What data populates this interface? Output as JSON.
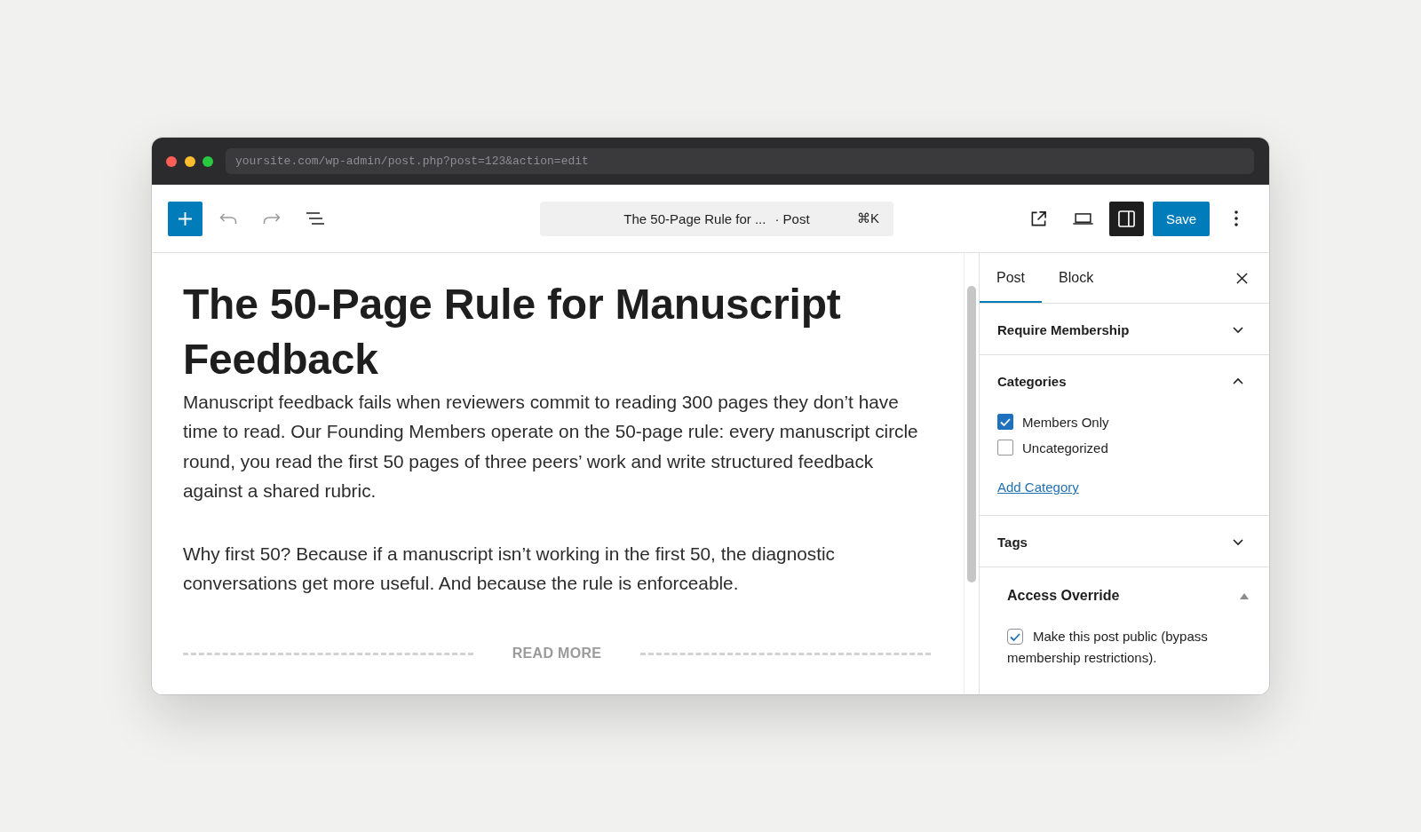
{
  "browser": {
    "url": "yoursite.com/wp-admin/post.php?post=123&action=edit"
  },
  "toolbar": {
    "undo": {
      "disabled": true
    },
    "redo": {
      "disabled": true
    },
    "document": {
      "title": "The 50-Page Rule for ...",
      "type": "· Post",
      "shortcut": "⌘K"
    },
    "settings_toggle": {
      "pressed": true
    },
    "save": "Save"
  },
  "editor": {
    "title": "The 50-Page Rule for Manuscript Feedback",
    "paragraphs": [
      "Manuscript feedback fails when reviewers commit to reading 300 pages they don’t have time to read. Our Founding Members operate on the 50-page rule: every manuscript circle round, you read the first 50 pages of three peers’ work and write structured feedback against a shared rubric.",
      "Why first 50? Because if a manuscript isn’t working in the first 50, the diagnostic conversations get more useful. And because the rule is enforceable."
    ],
    "read_more": "READ MORE"
  },
  "sidebar": {
    "tabs": [
      {
        "label": "Post",
        "selected": true
      },
      {
        "label": "Block",
        "selected": false
      }
    ],
    "panels": [
      {
        "kind": "panel",
        "title": "Require Membership",
        "expanded": false
      },
      {
        "kind": "panel",
        "title": "Categories",
        "expanded": true,
        "options": [
          {
            "label": "Members Only",
            "checked": true
          },
          {
            "label": "Uncategorized",
            "checked": false
          }
        ],
        "link": "Add Category"
      },
      {
        "kind": "panel",
        "title": "Tags",
        "expanded": false
      },
      {
        "kind": "metabox",
        "title": "Access Override",
        "expanded": true,
        "options": [
          {
            "label": "Make this post public (bypass membership restrictions).",
            "checked": true
          }
        ]
      }
    ]
  }
}
